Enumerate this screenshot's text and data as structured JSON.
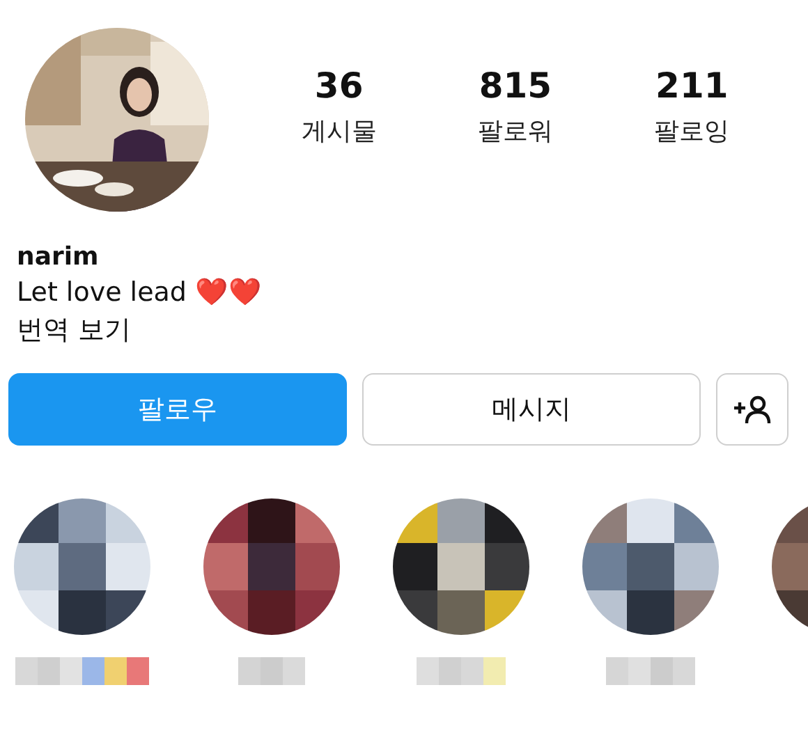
{
  "profile": {
    "username": "narim",
    "bio": "Let love lead ❤️❤️",
    "translate_link": "번역 보기"
  },
  "stats": [
    {
      "count": "36",
      "label": "게시물"
    },
    {
      "count": "815",
      "label": "팔로워"
    },
    {
      "count": "211",
      "label": "팔로잉"
    }
  ],
  "actions": {
    "follow": "팔로우",
    "message": "메시지"
  }
}
